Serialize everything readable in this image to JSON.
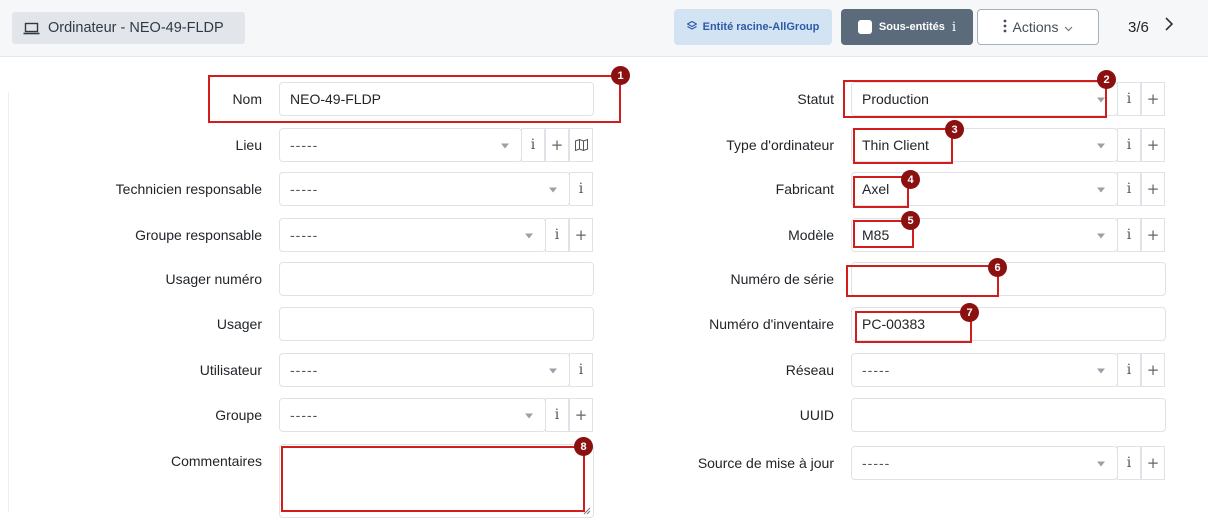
{
  "header": {
    "title": "Ordinateur - NEO-49-FLDP",
    "title_icon": "laptop-icon",
    "entity_button": "Entité racine-AllGroup",
    "subentities_button": "Sous-entités",
    "subentities_info": "i",
    "actions_button": "Actions",
    "pager": "3/6",
    "next_symbol": "›"
  },
  "left": {
    "nom": {
      "label": "Nom",
      "value": "NEO-49-FLDP"
    },
    "lieu": {
      "label": "Lieu",
      "value": "-----"
    },
    "technicien": {
      "label": "Technicien responsable",
      "value": "-----"
    },
    "groupe_resp": {
      "label": "Groupe responsable",
      "value": "-----"
    },
    "usager_num": {
      "label": "Usager numéro",
      "value": ""
    },
    "usager": {
      "label": "Usager",
      "value": ""
    },
    "utilisateur": {
      "label": "Utilisateur",
      "value": "-----"
    },
    "groupe": {
      "label": "Groupe",
      "value": "-----"
    },
    "commentaires": {
      "label": "Commentaires",
      "value": ""
    }
  },
  "right": {
    "statut": {
      "label": "Statut",
      "value": "Production"
    },
    "type": {
      "label": "Type d'ordinateur",
      "value": "Thin Client"
    },
    "fabricant": {
      "label": "Fabricant",
      "value": "Axel"
    },
    "modele": {
      "label": "Modèle",
      "value": "M85"
    },
    "serie": {
      "label": "Numéro de série",
      "value": ""
    },
    "inventaire": {
      "label": "Numéro d'inventaire",
      "value": "PC-00383"
    },
    "reseau": {
      "label": "Réseau",
      "value": "-----"
    },
    "uuid": {
      "label": "UUID",
      "value": ""
    },
    "source": {
      "label": "Source de mise à jour",
      "value": "-----"
    }
  },
  "addons": {
    "info": "i",
    "plus": "+"
  },
  "badges": [
    "1",
    "2",
    "3",
    "4",
    "5",
    "6",
    "7",
    "8"
  ],
  "colors": {
    "highlight": "#d11d1d",
    "badge": "#8b1111",
    "entity_bg": "#d2e3f3",
    "subentity_bg": "#5c6b7b"
  }
}
